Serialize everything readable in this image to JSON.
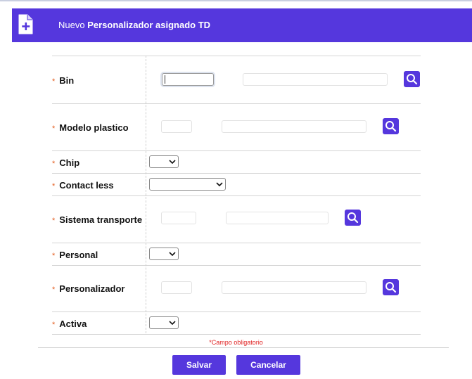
{
  "header": {
    "title_prefix": "Nuevo",
    "title_main": "Personalizador asignado TD"
  },
  "fields": [
    {
      "label": "Bin",
      "required_mark": "*"
    },
    {
      "label": "Modelo plastico",
      "required_mark": "*"
    },
    {
      "label": "Chip",
      "required_mark": "*"
    },
    {
      "label": "Contact less",
      "required_mark": "*"
    },
    {
      "label": "Sistema transporte",
      "required_mark": "*"
    },
    {
      "label": "Personal",
      "required_mark": "*"
    },
    {
      "label": "Personalizador",
      "required_mark": "*"
    },
    {
      "label": "Activa",
      "required_mark": "*"
    }
  ],
  "required_note": "*Campo obligatorio",
  "buttons": {
    "save": "Salvar",
    "cancel": "Cancelar"
  },
  "colors": {
    "accent": "#5537dd",
    "required": "#e35d1f"
  }
}
